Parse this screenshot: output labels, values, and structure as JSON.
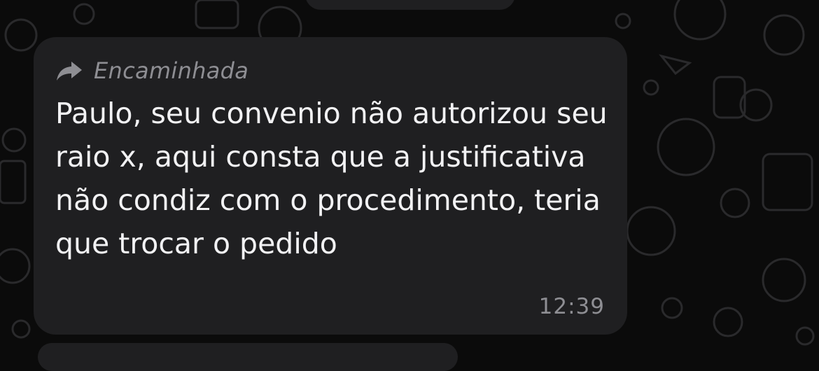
{
  "colors": {
    "background": "#0b0b0b",
    "bubble": "#1f1f21",
    "message_text": "#f2f2f4",
    "secondary_text": "#8e8e93",
    "doodle": "#2a2a2c"
  },
  "message": {
    "forwarded_icon": "forward-arrow-icon",
    "forwarded_label": "Encaminhada",
    "text": "Paulo, seu convenio não autorizou seu raio x, aqui consta que a justificativa não condiz com o procedimento, teria que trocar o pedido",
    "time": "12:39"
  }
}
